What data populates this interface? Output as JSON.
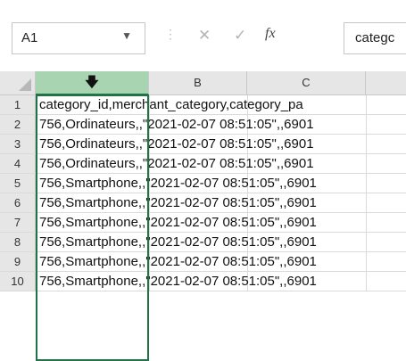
{
  "formula_bar": {
    "name_box": "A1",
    "cancel_icon": "close-icon",
    "enter_icon": "check-icon",
    "fx_label": "fx",
    "content": "categc"
  },
  "columns": [
    {
      "label": "",
      "icon": "down-arrow-icon",
      "selected": true
    },
    {
      "label": "B"
    },
    {
      "label": "C"
    }
  ],
  "rows": [
    {
      "num": "1",
      "text": "category_id,merchant_category,category_pa"
    },
    {
      "num": "2",
      "text": "756,Ordinateurs,,\"2021-02-07 08:51:05\",,6901"
    },
    {
      "num": "3",
      "text": "756,Ordinateurs,,\"2021-02-07 08:51:05\",,6901"
    },
    {
      "num": "4",
      "text": "756,Ordinateurs,,\"2021-02-07 08:51:05\",,6901"
    },
    {
      "num": "5",
      "text": "756,Smartphone,,\"2021-02-07 08:51:05\",,6901"
    },
    {
      "num": "6",
      "text": "756,Smartphone,,\"2021-02-07 08:51:05\",,6901"
    },
    {
      "num": "7",
      "text": "756,Smartphone,,\"2021-02-07 08:51:05\",,6901"
    },
    {
      "num": "8",
      "text": "756,Smartphone,,\"2021-02-07 08:51:05\",,6901"
    },
    {
      "num": "9",
      "text": "756,Smartphone,,\"2021-02-07 08:51:05\",,6901"
    },
    {
      "num": "10",
      "text": "756,Smartphone,,\"2021-02-07 08:51:05\",,6901"
    }
  ],
  "colors": {
    "selection": "#217346",
    "selected_header": "#a8d4b2",
    "header_bg": "#e6e6e6"
  }
}
